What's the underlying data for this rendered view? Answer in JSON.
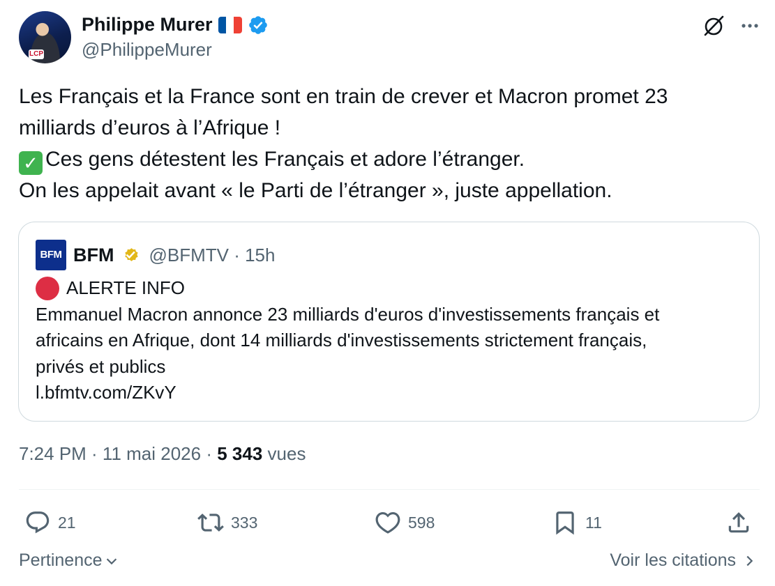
{
  "author": {
    "name": "Philippe Murer",
    "handle": "@PhilippeMurer",
    "avatar_badge": "LCP"
  },
  "tweet": {
    "line1": "Les Français et la France sont en train de crever et Macron promet 23",
    "line2": "milliards d’euros à l’Afrique !",
    "line3": "Ces gens détestent les Français et adore l’étranger.",
    "line4": "On les appelait avant « le Parti de l’étranger », juste appellation."
  },
  "quote": {
    "logo_text": "BFM",
    "name": "BFM",
    "handle_time": "@BFMTV · 15h",
    "alert": "ALERTE INFO",
    "body1": "Emmanuel Macron annonce 23 milliards d'euros d'investissements français et",
    "body2": "africains en Afrique, dont 14 milliards d'investissements strictement français,",
    "body3": "privés et publics",
    "link": "l.bfmtv.com/ZKvY"
  },
  "meta": {
    "time_date": "7:24 PM · 11 mai 2026 · ",
    "views_count": "5 343",
    "views_label": " vues"
  },
  "actions": {
    "replies": "21",
    "reposts": "333",
    "likes": "598",
    "bookmarks": "11"
  },
  "footer": {
    "sort_label": "Pertinence",
    "quotes_link": "Voir les citations"
  },
  "colors": {
    "text_primary": "#0f1419",
    "text_secondary": "#536471",
    "verified_blue": "#1d9bf0",
    "verified_gold": "#e2b719",
    "bfm_blue": "#0d2f8c",
    "alert_red": "#dd2e44",
    "check_green": "#3fb34f",
    "border": "#cfd9de"
  },
  "icons": {
    "grok": "grok-icon",
    "more": "more-icon",
    "reply": "reply-icon",
    "repost": "repost-icon",
    "like": "heart-icon",
    "bookmark": "bookmark-icon",
    "share": "share-icon"
  }
}
